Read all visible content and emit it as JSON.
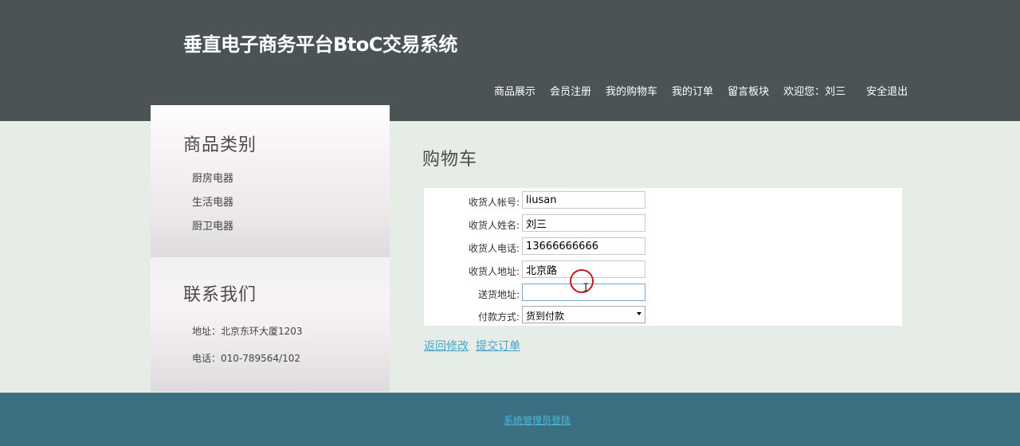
{
  "header": {
    "title": "垂直电子商务平台BtoC交易系统",
    "nav": {
      "products": "商品展示",
      "register": "会员注册",
      "cart": "我的购物车",
      "orders": "我的订单",
      "messages": "留言板块",
      "welcome": "欢迎您：刘三",
      "logout": "安全退出"
    }
  },
  "sidebar": {
    "categories_title": "商品类别",
    "categories": [
      "厨房电器",
      "生活电器",
      "厨卫电器"
    ],
    "contact_title": "联系我们",
    "address": "地址：北京东环大厦1203",
    "phone": "电话：010-789564/102"
  },
  "main": {
    "title": "购物车",
    "form": {
      "account_label": "收货人帐号:",
      "account_value": "liusan",
      "name_label": "收货人姓名:",
      "name_value": "刘三",
      "phone_label": "收货人电话:",
      "phone_value": "13666666666",
      "address_label": "收货人地址:",
      "address_value": "北京路",
      "delivery_label": "送货地址:",
      "delivery_value": "",
      "payment_label": "付款方式:",
      "payment_value": "货到付款"
    },
    "actions": {
      "back": "返回修改",
      "submit": "提交订单"
    }
  },
  "footer": {
    "admin_login": "系统管理员登陆"
  },
  "colors": {
    "header_bg": "#4b5355",
    "body_bg": "#e6ede6",
    "footer_bg": "#3a7082",
    "link": "#4aa3c8"
  }
}
